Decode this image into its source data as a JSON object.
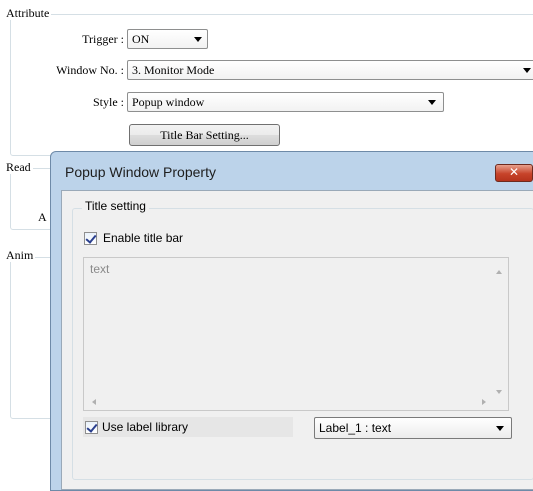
{
  "background": {
    "attribute_group": {
      "title": "Attribute",
      "trigger": {
        "label": "Trigger :",
        "value": "ON"
      },
      "window_no": {
        "label": "Window No. :",
        "value": "3. Monitor Mode"
      },
      "style": {
        "label": "Style :",
        "value": "Popup window"
      },
      "title_bar_button": "Title Bar Setting..."
    },
    "read_group": {
      "title": "Read"
    },
    "partial_letter": "A",
    "anim_group": {
      "title": "Anim"
    }
  },
  "dialog": {
    "title": "Popup Window Property",
    "close_glyph": "✕",
    "title_setting": {
      "title": "Title setting",
      "enable_title_bar": {
        "label": "Enable title bar",
        "checked": true
      },
      "text_value": "text",
      "use_label_library": {
        "label": "Use label library",
        "checked": true
      },
      "label_select": {
        "value": "Label_1 : text"
      }
    }
  },
  "colors": {
    "dialog_frame": "#bcd3ea",
    "close_button": "#c7432a",
    "client_bg": "#f0f0f0"
  }
}
